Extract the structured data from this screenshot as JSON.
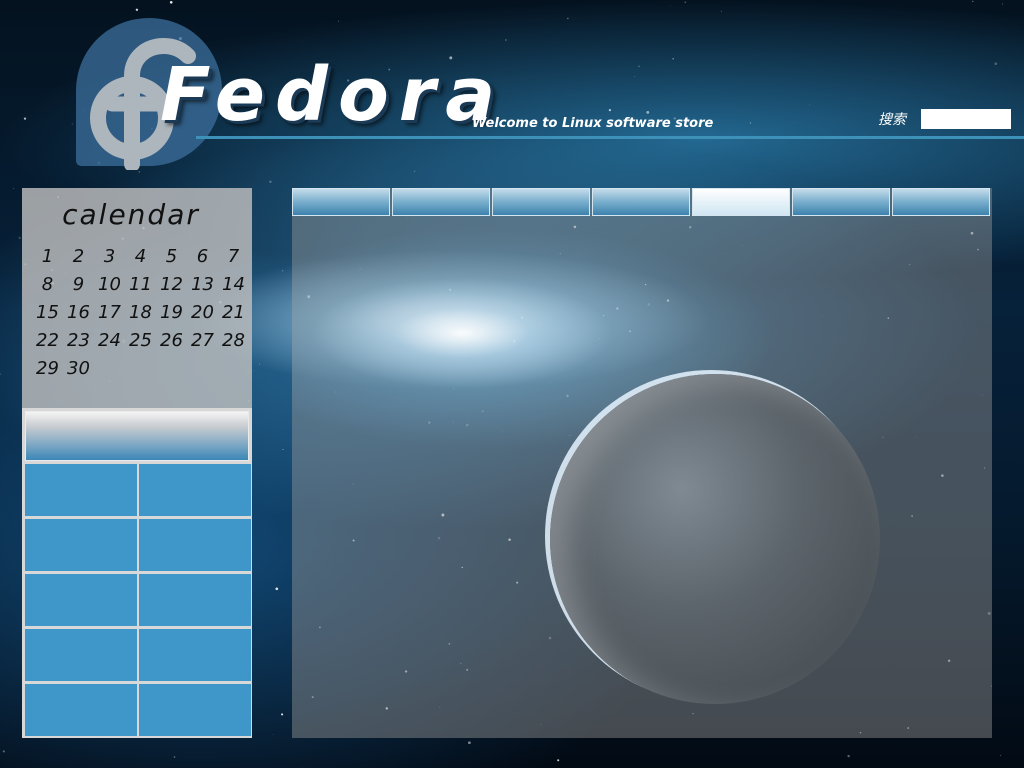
{
  "header": {
    "brand": "Fedora",
    "tagline": "Welcome to Linux software store",
    "search_label": "搜索",
    "search_value": ""
  },
  "calendar": {
    "title": "calendar",
    "days": [
      "1",
      "2",
      "3",
      "4",
      "5",
      "6",
      "7",
      "8",
      "9",
      "10",
      "11",
      "12",
      "13",
      "14",
      "15",
      "16",
      "17",
      "18",
      "19",
      "20",
      "21",
      "22",
      "23",
      "24",
      "25",
      "26",
      "27",
      "28",
      "29",
      "30"
    ]
  },
  "nav": {
    "tabs": [
      {
        "label": "",
        "active": false
      },
      {
        "label": "",
        "active": false
      },
      {
        "label": "",
        "active": false
      },
      {
        "label": "",
        "active": false
      },
      {
        "label": "",
        "active": true
      },
      {
        "label": "",
        "active": false
      },
      {
        "label": "",
        "active": false
      }
    ]
  },
  "sidebar": {
    "header_label": "",
    "cells": [
      "",
      "",
      "",
      "",
      "",
      "",
      "",
      "",
      "",
      ""
    ]
  },
  "colors": {
    "accent": "#3f96c8",
    "header_line": "#3d90b8"
  },
  "icons": {
    "logo": "fedora-logo-icon"
  }
}
